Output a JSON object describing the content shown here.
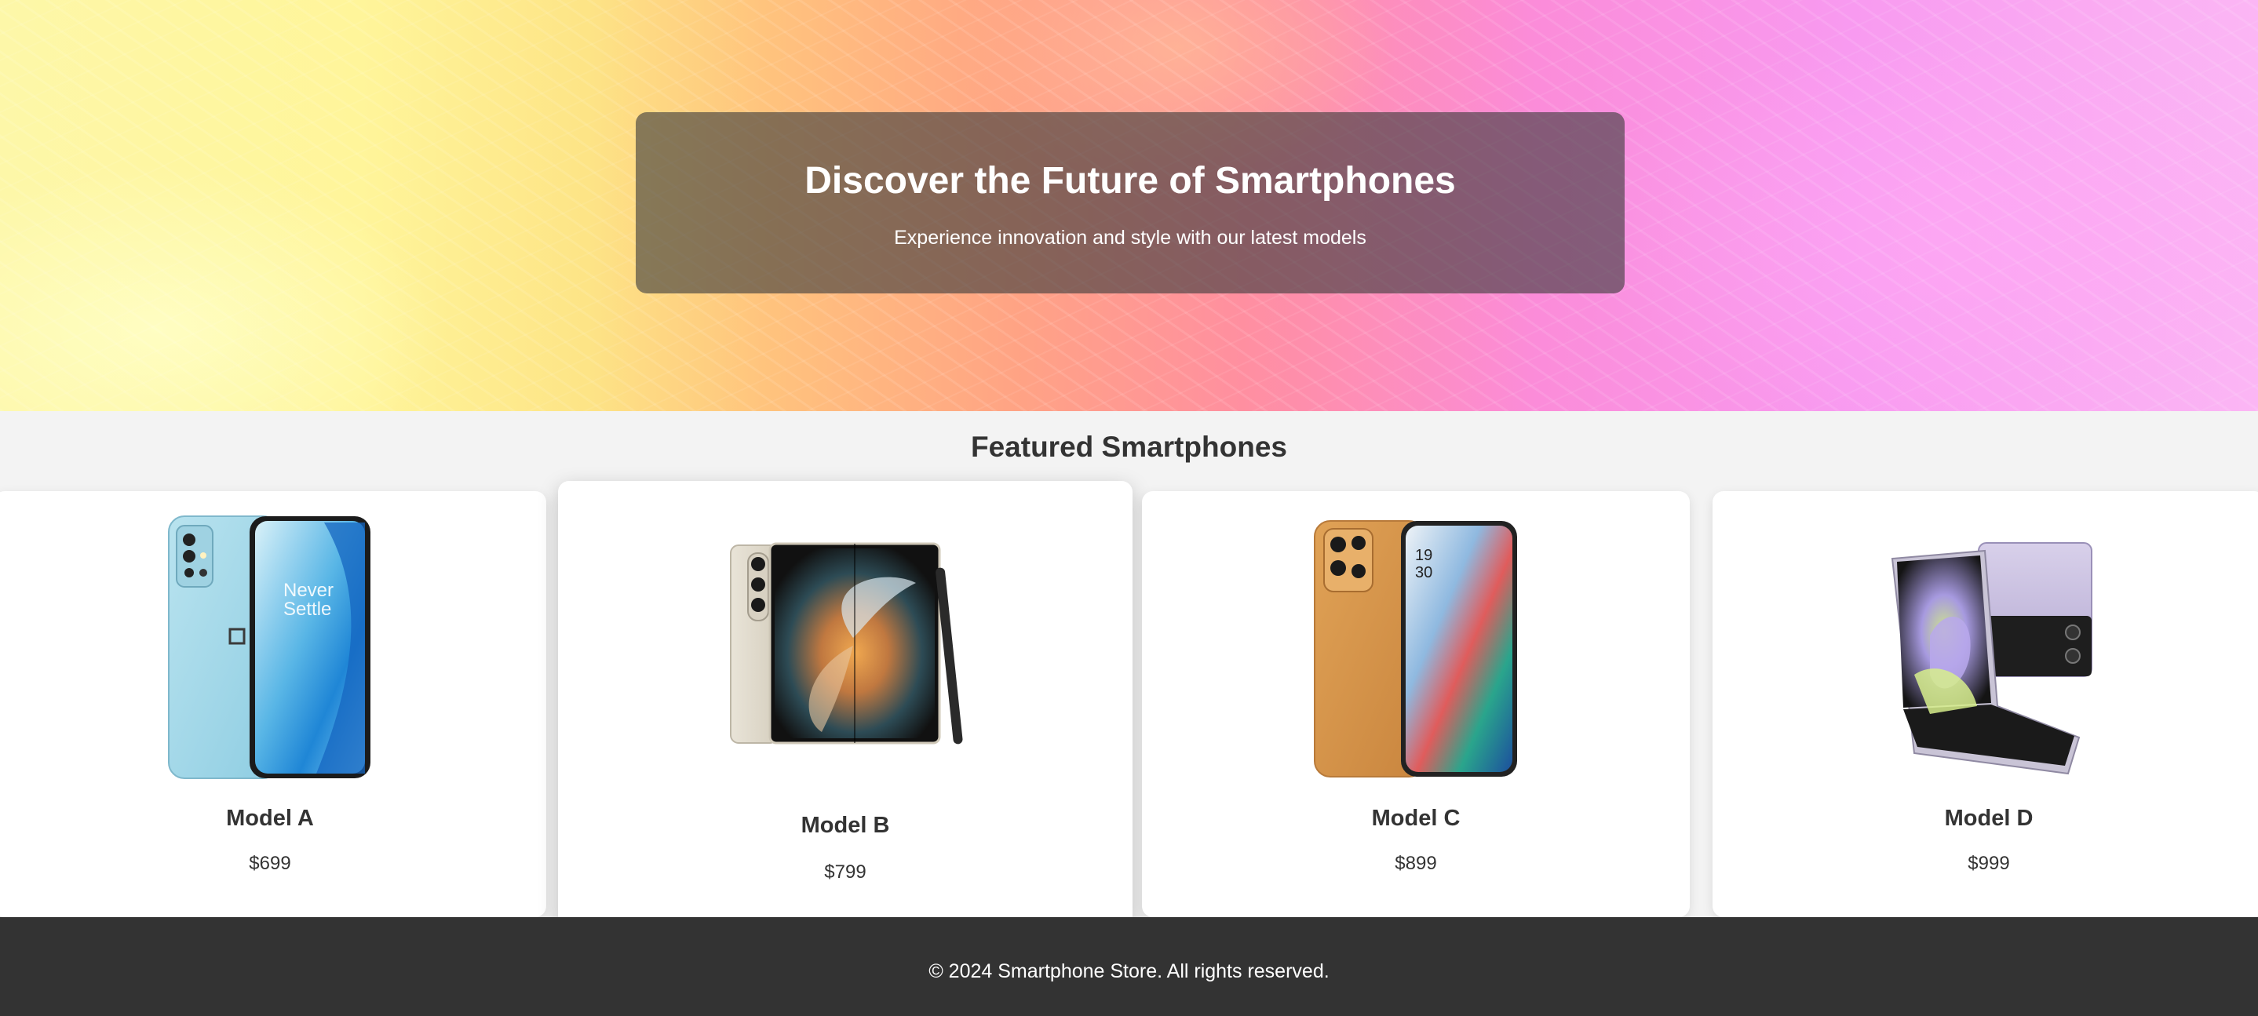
{
  "hero": {
    "title": "Discover the Future of Smartphones",
    "subtitle": "Experience innovation and style with our latest models"
  },
  "featured": {
    "title": "Featured Smartphones",
    "products": [
      {
        "name": "Model A",
        "price": "$699",
        "image_icon": "phone-blue-icon",
        "image_text": "Never Settle"
      },
      {
        "name": "Model B",
        "price": "$799",
        "image_icon": "foldable-phone-icon"
      },
      {
        "name": "Model C",
        "price": "$899",
        "image_icon": "phone-orange-icon",
        "image_text_time": "19 30"
      },
      {
        "name": "Model D",
        "price": "$999",
        "image_icon": "flip-phone-icon"
      }
    ]
  },
  "footer": {
    "text": "© 2024 Smartphone Store. All rights reserved."
  },
  "colors": {
    "hero_overlay": "#3c3c3c",
    "footer_bg": "#333333",
    "page_bg": "#f3f3f3",
    "card_bg": "#ffffff"
  }
}
